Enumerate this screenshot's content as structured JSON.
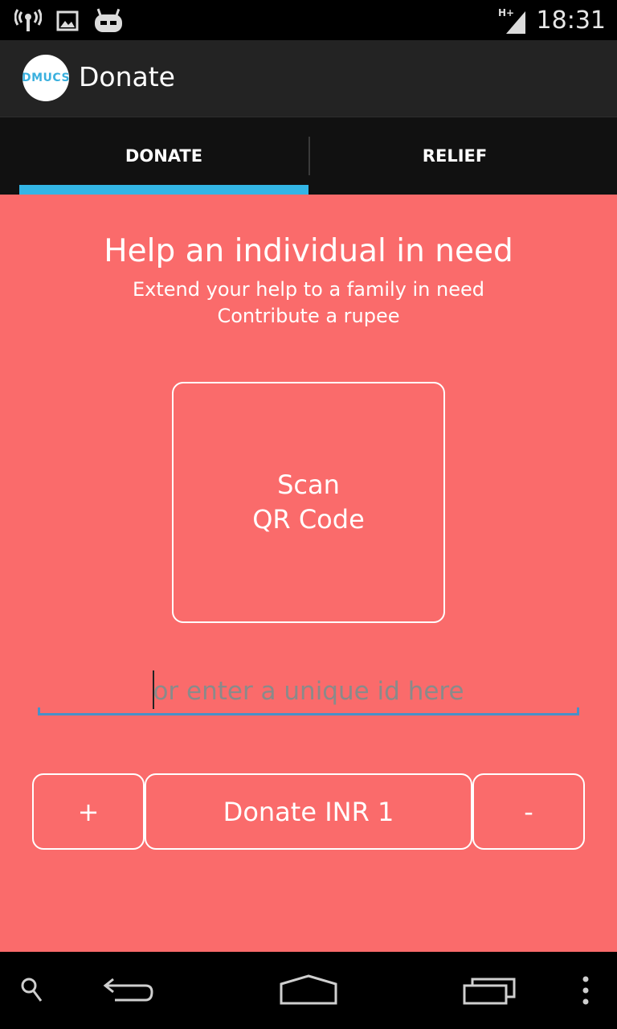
{
  "status_bar": {
    "time": "18:31",
    "network_type": "H+",
    "icons": [
      "wireless-signal-icon",
      "image-icon",
      "cyanogenmod-icon",
      "cell-signal-icon"
    ]
  },
  "action_bar": {
    "logo_text": "DMUCS",
    "title": "Donate"
  },
  "tabs": [
    {
      "label": "DONATE",
      "selected": true
    },
    {
      "label": "RELIEF",
      "selected": false
    }
  ],
  "colors": {
    "accent": "#33b5e5",
    "content_background": "#fa6b6b",
    "input_underline": "#4a90c8"
  },
  "main": {
    "headline": "Help an individual in need",
    "subline_1": "Extend your help to a family in need",
    "subline_2": "Contribute a rupee",
    "scan_button_line1": "Scan",
    "scan_button_line2": "QR Code",
    "id_input_placeholder": "or enter a unique id here",
    "id_input_value": "",
    "plus_label": "+",
    "donate_label": "Donate INR 1",
    "minus_label": "-"
  },
  "nav_bar": {
    "icons": [
      "search-icon",
      "back-icon",
      "home-icon",
      "recent-apps-icon",
      "overflow-menu-icon"
    ]
  }
}
